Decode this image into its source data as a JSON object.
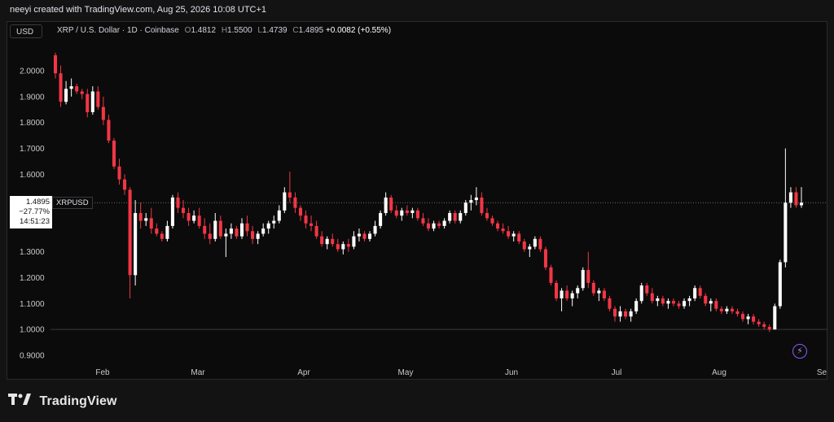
{
  "header": {
    "caption": "neeyi created with TradingView.com, Aug 25, 2026 10:08 UTC+1"
  },
  "toolbar": {
    "currency": "USD"
  },
  "legend": {
    "symbol": "XRP / U.S. Dollar · 1D · Coinbase",
    "o_label": "O",
    "o_value": "1.4812",
    "h_label": "H",
    "h_value": "1.5500",
    "l_label": "L",
    "l_value": "1.4739",
    "c_label": "C",
    "c_value": "1.4895",
    "change": "+0.0082 (+0.55%)"
  },
  "price_tag": {
    "price": "1.4895",
    "change": "−27.77%",
    "countdown": "14:51:23",
    "symbol": "XRPUSD"
  },
  "branding": {
    "name": "TradingView"
  },
  "colors": {
    "up": "#ffffff",
    "down": "#f23645",
    "background": "#0b0b0b",
    "grid": "#2a2a2a"
  },
  "icons": [
    "tradingview-logo-icon",
    "bolt-icon"
  ],
  "chart_data": {
    "type": "candlestick",
    "title": "XRP / U.S. Dollar · 1D · Coinbase",
    "y_ticks": [
      "2.0000",
      "1.9000",
      "1.8000",
      "1.7000",
      "1.6000",
      "1.3000",
      "1.2000",
      "1.1000",
      "1.0000",
      "0.9000"
    ],
    "x_ticks": [
      "Feb",
      "Mar",
      "Apr",
      "May",
      "Jun",
      "Jul",
      "Aug",
      "Se"
    ],
    "ylim": [
      0.87,
      2.1
    ],
    "reference_lines": [
      1.0
    ],
    "last_price": 1.4895,
    "ohlc": [
      [
        2.06,
        2.07,
        1.97,
        1.99
      ],
      [
        1.99,
        2.02,
        1.86,
        1.88
      ],
      [
        1.88,
        1.96,
        1.87,
        1.93
      ],
      [
        1.93,
        1.97,
        1.9,
        1.94
      ],
      [
        1.94,
        1.95,
        1.91,
        1.92
      ],
      [
        1.92,
        1.93,
        1.89,
        1.91
      ],
      [
        1.91,
        1.93,
        1.82,
        1.84
      ],
      [
        1.84,
        1.94,
        1.83,
        1.92
      ],
      [
        1.92,
        1.94,
        1.85,
        1.86
      ],
      [
        1.86,
        1.9,
        1.79,
        1.81
      ],
      [
        1.81,
        1.83,
        1.72,
        1.73
      ],
      [
        1.73,
        1.74,
        1.62,
        1.63
      ],
      [
        1.63,
        1.66,
        1.56,
        1.58
      ],
      [
        1.58,
        1.6,
        1.52,
        1.54
      ],
      [
        1.54,
        1.55,
        1.12,
        1.21
      ],
      [
        1.21,
        1.5,
        1.17,
        1.45
      ],
      [
        1.45,
        1.49,
        1.39,
        1.42
      ],
      [
        1.42,
        1.45,
        1.4,
        1.43
      ],
      [
        1.43,
        1.47,
        1.37,
        1.39
      ],
      [
        1.39,
        1.41,
        1.36,
        1.37
      ],
      [
        1.37,
        1.38,
        1.34,
        1.35
      ],
      [
        1.35,
        1.42,
        1.34,
        1.4
      ],
      [
        1.4,
        1.52,
        1.39,
        1.51
      ],
      [
        1.51,
        1.53,
        1.45,
        1.47
      ],
      [
        1.47,
        1.5,
        1.43,
        1.45
      ],
      [
        1.45,
        1.47,
        1.4,
        1.42
      ],
      [
        1.42,
        1.46,
        1.41,
        1.44
      ],
      [
        1.44,
        1.47,
        1.39,
        1.4
      ],
      [
        1.4,
        1.43,
        1.35,
        1.37
      ],
      [
        1.37,
        1.41,
        1.33,
        1.35
      ],
      [
        1.35,
        1.45,
        1.34,
        1.42
      ],
      [
        1.42,
        1.44,
        1.35,
        1.36
      ],
      [
        1.36,
        1.39,
        1.28,
        1.37
      ],
      [
        1.37,
        1.41,
        1.35,
        1.39
      ],
      [
        1.39,
        1.4,
        1.35,
        1.36
      ],
      [
        1.36,
        1.43,
        1.35,
        1.41
      ],
      [
        1.41,
        1.44,
        1.36,
        1.38
      ],
      [
        1.38,
        1.4,
        1.33,
        1.35
      ],
      [
        1.35,
        1.38,
        1.33,
        1.37
      ],
      [
        1.37,
        1.41,
        1.36,
        1.39
      ],
      [
        1.39,
        1.42,
        1.37,
        1.41
      ],
      [
        1.41,
        1.44,
        1.39,
        1.42
      ],
      [
        1.42,
        1.48,
        1.41,
        1.46
      ],
      [
        1.46,
        1.55,
        1.45,
        1.53
      ],
      [
        1.53,
        1.61,
        1.49,
        1.51
      ],
      [
        1.51,
        1.53,
        1.45,
        1.47
      ],
      [
        1.47,
        1.48,
        1.42,
        1.44
      ],
      [
        1.44,
        1.46,
        1.39,
        1.41
      ],
      [
        1.41,
        1.44,
        1.38,
        1.4
      ],
      [
        1.4,
        1.42,
        1.35,
        1.36
      ],
      [
        1.36,
        1.38,
        1.32,
        1.33
      ],
      [
        1.33,
        1.36,
        1.31,
        1.35
      ],
      [
        1.35,
        1.37,
        1.32,
        1.33
      ],
      [
        1.33,
        1.35,
        1.3,
        1.31
      ],
      [
        1.31,
        1.34,
        1.29,
        1.33
      ],
      [
        1.33,
        1.35,
        1.3,
        1.32
      ],
      [
        1.32,
        1.38,
        1.31,
        1.36
      ],
      [
        1.36,
        1.39,
        1.34,
        1.37
      ],
      [
        1.37,
        1.38,
        1.34,
        1.35
      ],
      [
        1.35,
        1.38,
        1.34,
        1.37
      ],
      [
        1.37,
        1.42,
        1.36,
        1.4
      ],
      [
        1.4,
        1.46,
        1.39,
        1.45
      ],
      [
        1.45,
        1.53,
        1.44,
        1.51
      ],
      [
        1.51,
        1.52,
        1.45,
        1.46
      ],
      [
        1.46,
        1.48,
        1.43,
        1.44
      ],
      [
        1.44,
        1.47,
        1.42,
        1.46
      ],
      [
        1.46,
        1.48,
        1.44,
        1.45
      ],
      [
        1.45,
        1.47,
        1.43,
        1.46
      ],
      [
        1.46,
        1.47,
        1.42,
        1.43
      ],
      [
        1.43,
        1.45,
        1.4,
        1.41
      ],
      [
        1.41,
        1.43,
        1.38,
        1.39
      ],
      [
        1.39,
        1.42,
        1.38,
        1.41
      ],
      [
        1.41,
        1.42,
        1.39,
        1.4
      ],
      [
        1.4,
        1.43,
        1.39,
        1.42
      ],
      [
        1.42,
        1.46,
        1.41,
        1.45
      ],
      [
        1.45,
        1.46,
        1.41,
        1.42
      ],
      [
        1.42,
        1.46,
        1.41,
        1.45
      ],
      [
        1.45,
        1.5,
        1.44,
        1.49
      ],
      [
        1.49,
        1.52,
        1.46,
        1.5
      ],
      [
        1.5,
        1.55,
        1.48,
        1.51
      ],
      [
        1.51,
        1.53,
        1.44,
        1.45
      ],
      [
        1.45,
        1.47,
        1.42,
        1.43
      ],
      [
        1.43,
        1.44,
        1.4,
        1.41
      ],
      [
        1.41,
        1.42,
        1.38,
        1.39
      ],
      [
        1.39,
        1.41,
        1.37,
        1.38
      ],
      [
        1.38,
        1.4,
        1.35,
        1.36
      ],
      [
        1.36,
        1.38,
        1.34,
        1.37
      ],
      [
        1.37,
        1.38,
        1.33,
        1.34
      ],
      [
        1.34,
        1.35,
        1.3,
        1.31
      ],
      [
        1.31,
        1.33,
        1.28,
        1.32
      ],
      [
        1.32,
        1.36,
        1.31,
        1.35
      ],
      [
        1.35,
        1.36,
        1.3,
        1.31
      ],
      [
        1.31,
        1.32,
        1.23,
        1.24
      ],
      [
        1.24,
        1.25,
        1.17,
        1.18
      ],
      [
        1.18,
        1.19,
        1.11,
        1.12
      ],
      [
        1.12,
        1.16,
        1.07,
        1.15
      ],
      [
        1.15,
        1.17,
        1.11,
        1.12
      ],
      [
        1.12,
        1.15,
        1.09,
        1.14
      ],
      [
        1.14,
        1.17,
        1.12,
        1.16
      ],
      [
        1.16,
        1.24,
        1.15,
        1.23
      ],
      [
        1.23,
        1.3,
        1.16,
        1.18
      ],
      [
        1.18,
        1.19,
        1.13,
        1.14
      ],
      [
        1.14,
        1.16,
        1.11,
        1.15
      ],
      [
        1.15,
        1.16,
        1.11,
        1.12
      ],
      [
        1.12,
        1.13,
        1.07,
        1.08
      ],
      [
        1.08,
        1.09,
        1.03,
        1.05
      ],
      [
        1.05,
        1.09,
        1.03,
        1.07
      ],
      [
        1.07,
        1.08,
        1.04,
        1.05
      ],
      [
        1.05,
        1.08,
        1.03,
        1.07
      ],
      [
        1.07,
        1.12,
        1.06,
        1.11
      ],
      [
        1.11,
        1.18,
        1.1,
        1.17
      ],
      [
        1.17,
        1.18,
        1.13,
        1.14
      ],
      [
        1.14,
        1.16,
        1.1,
        1.11
      ],
      [
        1.11,
        1.13,
        1.09,
        1.12
      ],
      [
        1.12,
        1.13,
        1.09,
        1.1
      ],
      [
        1.1,
        1.12,
        1.08,
        1.11
      ],
      [
        1.11,
        1.12,
        1.09,
        1.1
      ],
      [
        1.1,
        1.11,
        1.08,
        1.09
      ],
      [
        1.09,
        1.12,
        1.08,
        1.11
      ],
      [
        1.11,
        1.13,
        1.09,
        1.12
      ],
      [
        1.12,
        1.17,
        1.11,
        1.16
      ],
      [
        1.16,
        1.17,
        1.12,
        1.13
      ],
      [
        1.13,
        1.14,
        1.09,
        1.1
      ],
      [
        1.1,
        1.12,
        1.07,
        1.11
      ],
      [
        1.11,
        1.12,
        1.07,
        1.08
      ],
      [
        1.08,
        1.09,
        1.06,
        1.07
      ],
      [
        1.07,
        1.09,
        1.06,
        1.08
      ],
      [
        1.08,
        1.09,
        1.06,
        1.07
      ],
      [
        1.07,
        1.08,
        1.05,
        1.06
      ],
      [
        1.06,
        1.07,
        1.03,
        1.04
      ],
      [
        1.04,
        1.06,
        1.02,
        1.05
      ],
      [
        1.05,
        1.06,
        1.02,
        1.03
      ],
      [
        1.03,
        1.04,
        1.01,
        1.02
      ],
      [
        1.02,
        1.03,
        1.0,
        1.01
      ],
      [
        1.01,
        1.02,
        0.99,
        1.0
      ],
      [
        1.0,
        1.1,
        1.0,
        1.09
      ],
      [
        1.09,
        1.27,
        1.08,
        1.26
      ],
      [
        1.26,
        1.7,
        1.24,
        1.49
      ],
      [
        1.49,
        1.55,
        1.47,
        1.53
      ],
      [
        1.53,
        1.55,
        1.47,
        1.48
      ],
      [
        1.48,
        1.55,
        1.47,
        1.49
      ]
    ]
  }
}
